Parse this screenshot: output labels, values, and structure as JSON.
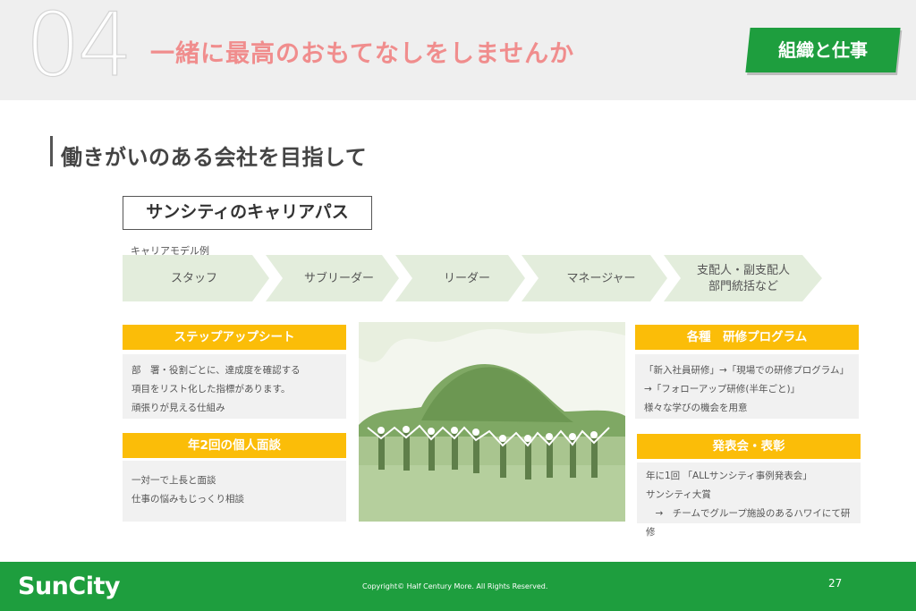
{
  "header": {
    "section_number": "04",
    "title": "一緒に最高のおもてなしをしませんか",
    "badge": "組織と仕事"
  },
  "page_heading": "働きがいのある会社を目指して",
  "career_path": {
    "title": "サンシティのキャリアパス",
    "model_label": "キャリアモデル例",
    "steps": [
      "スタッフ",
      "サブリーダー",
      "リーダー",
      "マネージャー",
      "支配人・副支配人\n部門統括など"
    ]
  },
  "left_cards": [
    {
      "heading": "ステップアップシート",
      "lines": [
        "部　署・役割ごとに、達成度を確認する",
        "項目をリスト化した指標があります。",
        "頑張りが見える仕組み"
      ]
    },
    {
      "heading": "年2回の個人面談",
      "lines": [
        "一対一で上長と面談",
        "仕事の悩みもじっくり相談"
      ]
    }
  ],
  "right_cards": [
    {
      "heading": "各種　研修プログラム",
      "lines": [
        "「新入社員研修」→「現場での研修プログラム」",
        "→「フォローアップ研修(半年ごと)」",
        "様々な学びの機会を用意"
      ]
    },
    {
      "heading": "発表会・表彰",
      "lines": [
        "年に1回 「ALLサンシティ事例発表会」",
        "サンシティ大賞",
        "　→　チームでグループ施設のあるハワイにて研修"
      ]
    }
  ],
  "photo": {
    "icon": "group-photo-image"
  },
  "footer": {
    "logo": "SunCity",
    "copyright": "Copyright© Half Century More. All Rights Reserved.",
    "page_number": "27"
  },
  "colors": {
    "brand_green": "#1e9e3e",
    "accent_orange": "#fbbd08",
    "title_pink": "#f08d8d",
    "path_green": "#e3eddc"
  }
}
